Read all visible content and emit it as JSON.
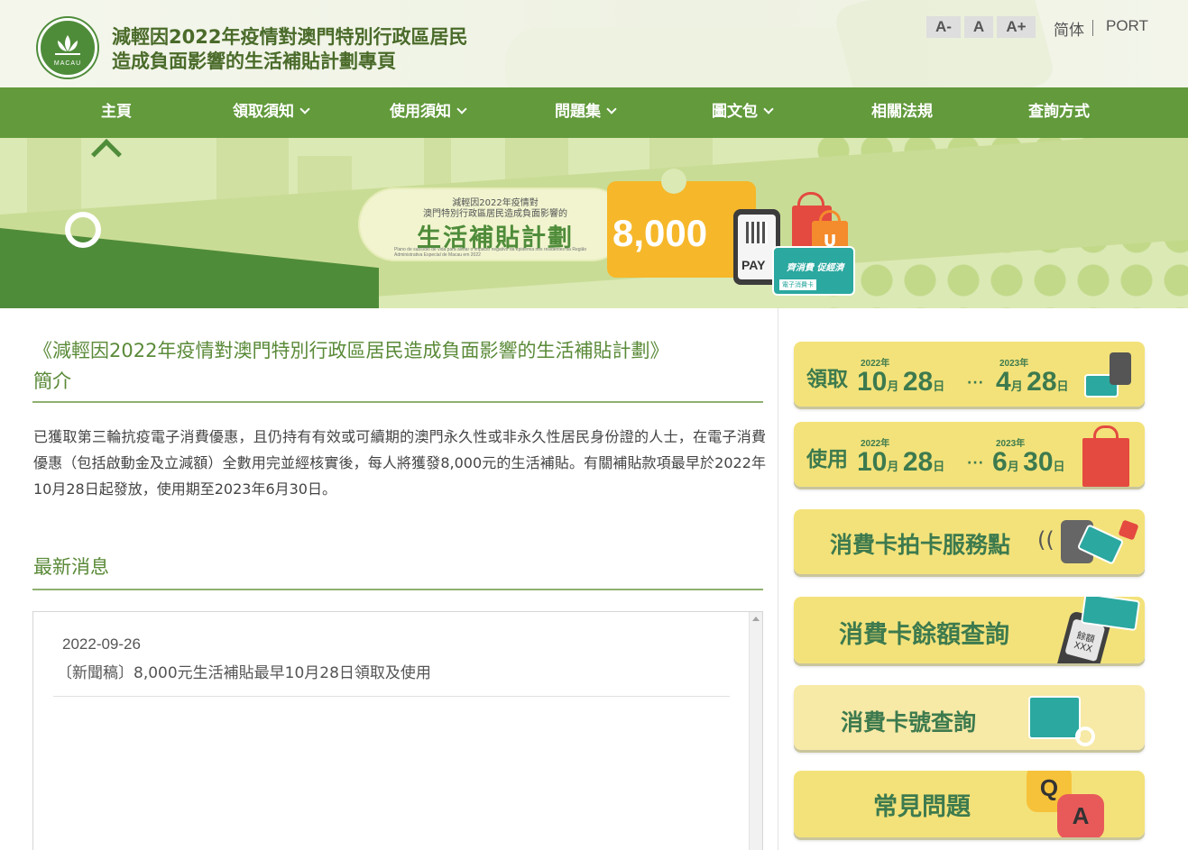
{
  "header": {
    "title_line1": "減輕因2022年疫情對澳門特別行政區居民",
    "title_line2": "造成負面影響的生活補貼計劃專頁",
    "logo_text": "MACAU",
    "font_decrease": "A-",
    "font_normal": "A",
    "font_increase": "A+",
    "lang_simplified": "简体",
    "lang_port": "PORT"
  },
  "nav": {
    "items": [
      {
        "label": "主頁",
        "dropdown": false
      },
      {
        "label": "領取須知",
        "dropdown": true
      },
      {
        "label": "使用須知",
        "dropdown": true
      },
      {
        "label": "問題集",
        "dropdown": true
      },
      {
        "label": "圖文包",
        "dropdown": true
      },
      {
        "label": "相關法規",
        "dropdown": false
      },
      {
        "label": "查詢方式",
        "dropdown": false
      }
    ]
  },
  "banner": {
    "line1": "減輕因2022年疫情對",
    "line2": "澳門特別行政區居民造成負面影響的",
    "main": "生活補貼計劃",
    "pt_text": "Plano de subsídio de vida para aliviar o impacto negativo da epidemia nos residentes da Região Administrativa Especial de Macau em 2022",
    "amount": "8,000",
    "pay": "PAY",
    "bag_letter": "U",
    "card_title": "齊消費 促經濟",
    "card_bottom": "電子消費卡"
  },
  "intro": {
    "title_line1": "《減輕因2022年疫情對澳門特別行政區居民造成負面影響的生活補貼計劃》",
    "title_line2": "簡介",
    "body": "已獲取第三輪抗疫電子消費優惠，且仍持有有效或可續期的澳門永久性或非永久性居民身份證的人士，在電子消費優惠（包括啟動金及立減額）全數用完並經核實後，每人將獲發8,000元的生活補貼。有關補貼款項最早於2022年10月28日起發放，使用期至2023年6月30日。"
  },
  "news": {
    "title": "最新消息",
    "items": [
      {
        "date": "2022-09-26",
        "text": "〔新聞稿〕8,000元生活補貼最早10月28日領取及使用"
      }
    ]
  },
  "sidebar": {
    "collect": {
      "label": "領取",
      "start_year": "2022年",
      "start_month": "10",
      "start_day": "28",
      "end_year": "2023年",
      "end_month": "4",
      "end_day": "28",
      "month_unit": "月",
      "day_unit": "日",
      "range_sep": "···"
    },
    "use": {
      "label": "使用",
      "start_year": "2022年",
      "start_month": "10",
      "start_day": "28",
      "end_year": "2023年",
      "end_month": "6",
      "end_day": "30",
      "month_unit": "月",
      "day_unit": "日",
      "range_sep": "···"
    },
    "service_points": "消費卡拍卡服務點",
    "balance_query": "消費卡餘額查詢",
    "card_number_query": "消費卡號查詢",
    "faq": "常見問題",
    "phone_text": "餘額",
    "phone_mask": "XXX",
    "q_letter": "Q",
    "a_letter": "A"
  },
  "colors": {
    "nav_green": "#629a3c",
    "title_green": "#5a8a38",
    "tile_yellow": "#f3e27a",
    "tile_teal_text": "#3d7a4e",
    "ticket_orange": "#f6b72a"
  }
}
